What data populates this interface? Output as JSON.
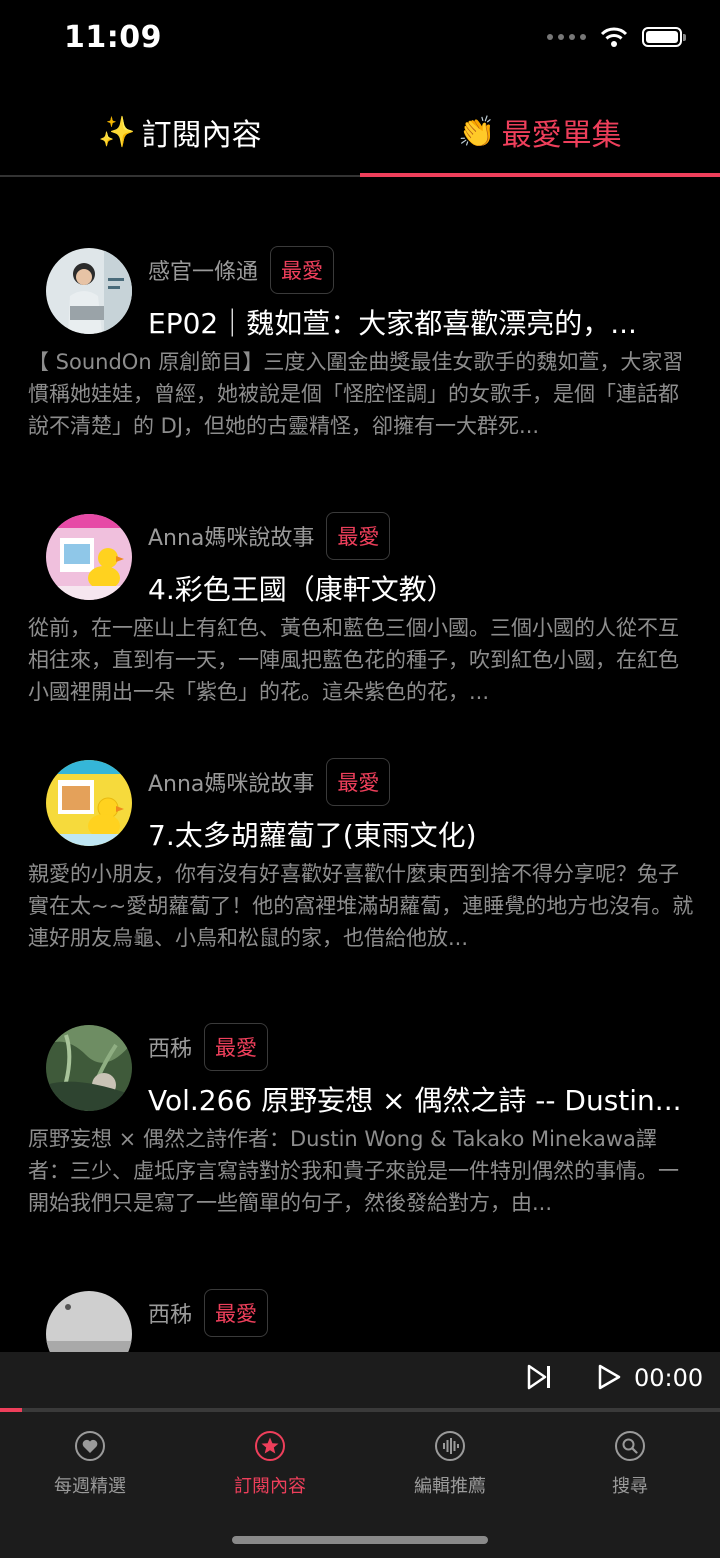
{
  "status_bar": {
    "time": "11:09"
  },
  "tabs": [
    {
      "emoji": "✨",
      "label": "訂閱內容",
      "active": false
    },
    {
      "emoji": "👏",
      "label": "最愛單集",
      "active": true
    }
  ],
  "episodes": [
    {
      "author": "感官一條通",
      "badge": "最愛",
      "title": "EP02｜魏如萱：大家都喜歡漂亮的，...",
      "description": "【 SoundOn 原創節目】三度入圍金曲獎最佳女歌手的魏如萱，大家習慣稱她娃娃，曾經，她被說是個「怪腔怪調」的女歌手，是個「連話都說不清楚」的 DJ，但她的古靈精怪，卻擁有一大群死..."
    },
    {
      "author": "Anna媽咪說故事",
      "badge": "最愛",
      "title": "4.彩色王國（康軒文教）",
      "description": "從前，在一座山上有紅色、黃色和藍色三個小國。三個小國的人從不互相往來，直到有一天，一陣風把藍色花的種子，吹到紅色小國，在紅色小國裡開出一朵「紫色」的花。這朵紫色的花，..."
    },
    {
      "author": "Anna媽咪說故事",
      "badge": "最愛",
      "title": "7.太多胡蘿蔔了(東雨文化)",
      "description": "親愛的小朋友，你有沒有好喜歡好喜歡什麼東西到捨不得分享呢？兔子實在太~~愛胡蘿蔔了！他的窩裡堆滿胡蘿蔔，連睡覺的地方也沒有。就連好朋友烏龜、小鳥和松鼠的家，也借給他放..."
    },
    {
      "author": "西秭",
      "badge": "最愛",
      "title": "Vol.266 原野妄想 × 偶然之詩 -- Dustin...",
      "description": "原野妄想 × 偶然之詩作者：Dustin Wong & Takako Minekawa譯者：三少、虛坻序言寫詩對於我和貴子來說是一件特別偶然的事情。一開始我們只是寫了一些簡單的句子，然後發給對方，由..."
    },
    {
      "author": "西秭",
      "badge": "最愛",
      "title": "",
      "description": ""
    }
  ],
  "player": {
    "time": "00:00",
    "progress": 0.03
  },
  "bottom_nav": [
    {
      "label": "每週精選",
      "icon": "heart-icon",
      "active": false
    },
    {
      "label": "訂閱內容",
      "icon": "star-icon",
      "active": true
    },
    {
      "label": "編輯推薦",
      "icon": "waveform-icon",
      "active": false
    },
    {
      "label": "搜尋",
      "icon": "search-icon",
      "active": false
    }
  ],
  "colors": {
    "accent": "#ee3f5b",
    "background": "#000000",
    "bar": "#1c1c1c"
  }
}
